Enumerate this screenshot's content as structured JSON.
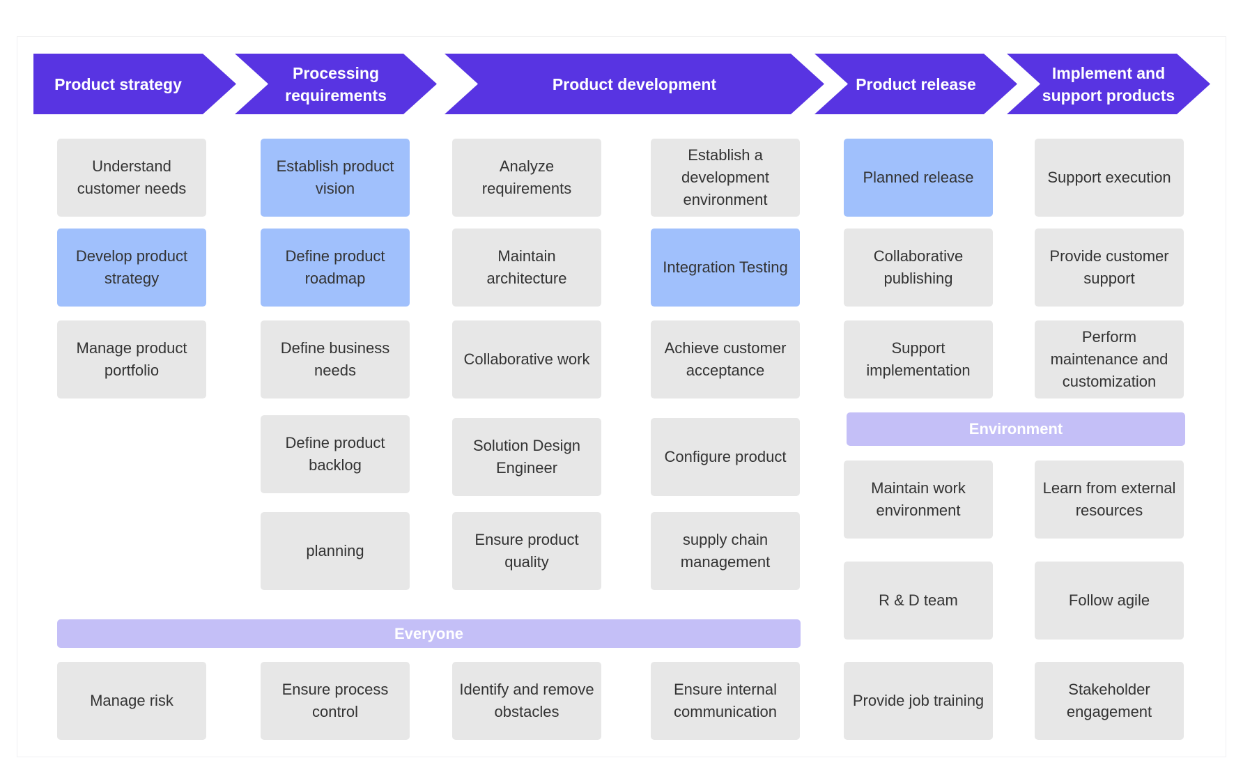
{
  "colors": {
    "arrow": "#5834E2",
    "card": "#E7E7E7",
    "highlight": "#A0C0FC",
    "group_bar": "#C4BFF7"
  },
  "stages": [
    {
      "label": "Product strategy"
    },
    {
      "label": "Processing requirements"
    },
    {
      "label": "Product development"
    },
    {
      "label": "Product release"
    },
    {
      "label": "Implement and support products"
    }
  ],
  "columns": [
    {
      "items": [
        {
          "text": "Understand customer needs",
          "highlight": false
        },
        {
          "text": "Develop product strategy",
          "highlight": true
        },
        {
          "text": "Manage product portfolio",
          "highlight": false
        }
      ]
    },
    {
      "items": [
        {
          "text": "Establish product vision",
          "highlight": true
        },
        {
          "text": "Define product roadmap",
          "highlight": true
        },
        {
          "text": "Define business needs",
          "highlight": false
        },
        {
          "text": "Define product backlog",
          "highlight": false
        },
        {
          "text": "planning",
          "highlight": false
        }
      ]
    },
    {
      "items": [
        {
          "text": "Analyze requirements",
          "highlight": false
        },
        {
          "text": "Maintain architecture",
          "highlight": false
        },
        {
          "text": "Collaborative work",
          "highlight": false
        },
        {
          "text": "Solution Design Engineer",
          "highlight": false
        },
        {
          "text": "Ensure product quality",
          "highlight": false
        }
      ]
    },
    {
      "items": [
        {
          "text": "Establish a development environment",
          "highlight": false
        },
        {
          "text": "Integration Testing",
          "highlight": true
        },
        {
          "text": "Achieve customer acceptance",
          "highlight": false
        },
        {
          "text": "Configure product",
          "highlight": false
        },
        {
          "text": "supply chain management",
          "highlight": false
        }
      ]
    },
    {
      "items": [
        {
          "text": "Planned release",
          "highlight": true
        },
        {
          "text": "Collaborative publishing",
          "highlight": false
        },
        {
          "text": "Support implementation",
          "highlight": false
        }
      ]
    },
    {
      "items": [
        {
          "text": "Support execution",
          "highlight": false
        },
        {
          "text": "Provide customer support",
          "highlight": false
        },
        {
          "text": "Perform maintenance and customization",
          "highlight": false
        }
      ]
    }
  ],
  "everyone": {
    "label": "Everyone",
    "items": [
      "Manage risk",
      "Ensure process control",
      "Identify and remove obstacles",
      "Ensure internal communication"
    ]
  },
  "environment": {
    "label": "Environment",
    "items": [
      "Maintain work environment",
      "Learn from external resources",
      "R & D team",
      "Follow agile",
      "Provide job training",
      "Stakeholder engagement"
    ]
  }
}
